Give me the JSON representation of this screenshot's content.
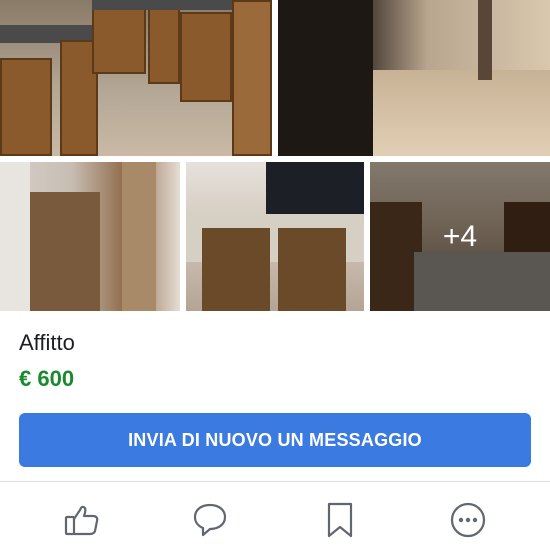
{
  "listing": {
    "title": "Affitto",
    "price": "€ 600",
    "more_photos": "+4"
  },
  "photos": [
    {
      "name": "kitchen-photo"
    },
    {
      "name": "hallway-photo"
    },
    {
      "name": "living-room-photo"
    },
    {
      "name": "dining-photo"
    },
    {
      "name": "bedroom-photo"
    }
  ],
  "actions": {
    "message_button": "INVIA DI NUOVO UN MESSAGGIO",
    "like_icon": "thumbs-up-icon",
    "comment_icon": "comment-icon",
    "save_icon": "bookmark-icon",
    "more_icon": "more-icon"
  },
  "colors": {
    "price": "#1b8a2e",
    "button": "#3b7ae0",
    "icon": "#606770"
  }
}
